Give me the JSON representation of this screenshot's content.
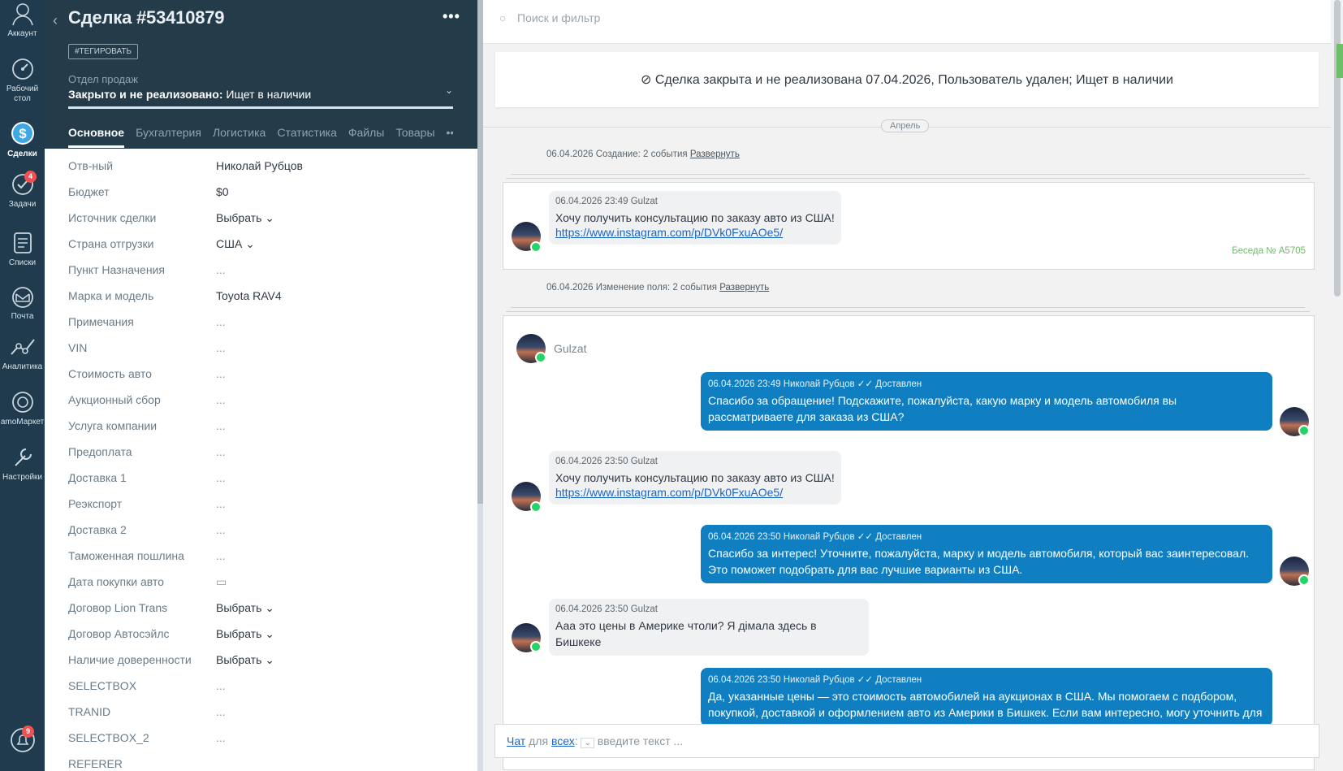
{
  "nav": {
    "items": [
      {
        "label": "Аккаунт",
        "icon": "account-icon"
      },
      {
        "label": "Рабочий стол",
        "icon": "dashboard-icon"
      },
      {
        "label": "Сделки",
        "icon": "deals-icon"
      },
      {
        "label": "Задачи",
        "icon": "tasks-icon",
        "badge": "4"
      },
      {
        "label": "Списки",
        "icon": "lists-icon"
      },
      {
        "label": "Почта",
        "icon": "mail-icon"
      },
      {
        "label": "Аналитика",
        "icon": "analytics-icon"
      },
      {
        "label": "amoМаркет",
        "icon": "market-icon"
      },
      {
        "label": "Настройки",
        "icon": "settings-icon"
      }
    ],
    "notifications_badge": "9"
  },
  "card": {
    "title": "Сделка #53410879",
    "menu": "•••",
    "tag_button": "#ТЕГИРОВАТЬ",
    "pipeline_label": "Отдел продаж",
    "pipeline_status": "Закрыто и не реализовано:",
    "pipeline_reason": "Ищет в наличии",
    "tabs": [
      "Основное",
      "Бухгалтерия",
      "Логистика",
      "Статистика",
      "Файлы",
      "Товары",
      "•••"
    ],
    "fields": [
      {
        "label": "Отв-ный",
        "value": "Николай Рубцов"
      },
      {
        "label": "Бюджет",
        "value": "$0"
      },
      {
        "label": "Источник сделки",
        "value": "Выбрать ⌄"
      },
      {
        "label": "Страна отгрузки",
        "value": "США ⌄"
      },
      {
        "label": "Пункт Назначения",
        "value": "..."
      },
      {
        "label": "Марка и модель",
        "value": "Toyota RAV4"
      },
      {
        "label": "Примечания",
        "value": "..."
      },
      {
        "label": "VIN",
        "value": "..."
      },
      {
        "label": "Стоимость авто",
        "value": "..."
      },
      {
        "label": "Аукционный сбор",
        "value": "..."
      },
      {
        "label": "Услуга компании",
        "value": "..."
      },
      {
        "label": "Предоплата",
        "value": "..."
      },
      {
        "label": "Доставка 1",
        "value": "..."
      },
      {
        "label": "Реэкспорт",
        "value": "..."
      },
      {
        "label": "Доставка 2",
        "value": "..."
      },
      {
        "label": "Таможенная пошлина",
        "value": "..."
      },
      {
        "label": "Дата покупки авто",
        "value": "▭"
      },
      {
        "label": "Договор Lion Trans",
        "value": "Выбрать ⌄"
      },
      {
        "label": "Договор Автосэйлс",
        "value": "Выбрать ⌄"
      },
      {
        "label": "Наличие доверенности",
        "value": "Выбрать ⌄"
      },
      {
        "label": "SELECTBOX",
        "value": "..."
      },
      {
        "label": "TRANID",
        "value": "..."
      },
      {
        "label": "SELECTBOX_2",
        "value": "..."
      },
      {
        "label": "REFERER",
        "value": ""
      }
    ]
  },
  "feed": {
    "search_placeholder": "Поиск и фильтр",
    "closed_banner": "Сделка закрыта и не реализована 07.04.2026, Пользователь удален; Ищет в наличии",
    "month": "Апрель",
    "event1": {
      "text": "06.04.2026 Создание: 2 события",
      "link": "Развернуть"
    },
    "event2": {
      "text": "06.04.2026 Изменение поля: 2 события",
      "link": "Развернуть"
    },
    "conversation_label": "Беседа № A5705",
    "first_msg": {
      "meta": "06.04.2026 23:49 Gulzat",
      "text": "Хочу получить консультацию по заказу авто из США!",
      "link": "https://www.instagram.com/p/DVk0FxuAOe5/"
    },
    "chat_user": "Gulzat",
    "messages": [
      {
        "dir": "out",
        "meta": "06.04.2026 23:49 Николай Рубцов",
        "status": "✓✓ Доставлен",
        "text": "Спасибо за обращение! Подскажите, пожалуйста, какую марку и модель автомобиля вы рассматриваете для заказа из США?"
      },
      {
        "dir": "in",
        "meta": "06.04.2026 23:50 Gulzat",
        "text": "Хочу получить консультацию по заказу авто из США!",
        "link": "https://www.instagram.com/p/DVk0FxuAOe5/"
      },
      {
        "dir": "out",
        "meta": "06.04.2026 23:50 Николай Рубцов",
        "status": "✓✓ Доставлен",
        "text": "Спасибо за интерес! Уточните, пожалуйста, марку и модель автомобиля, который вас заинтересовал. Это поможет подобрать для вас лучшие варианты из США."
      },
      {
        "dir": "in",
        "meta": "06.04.2026 23:50 Gulzat",
        "text": "Ааа это цены в Америке чтоли? Я дімала здесь в Бишкеке"
      },
      {
        "dir": "out",
        "meta": "06.04.2026 23:50 Николай Рубцов",
        "status": "✓✓ Доставлен",
        "text": "Да, указанные цены — это стоимость автомобилей на аукционах в США. Мы помогаем с подбором, покупкой, доставкой и оформлением авто из Америки в Бишкек. Если вам интересно, могу уточнить для"
      }
    ],
    "chat_input": {
      "chat": "Чат",
      "for": "для",
      "all": "всех",
      "placeholder": "введите текст ..."
    }
  }
}
